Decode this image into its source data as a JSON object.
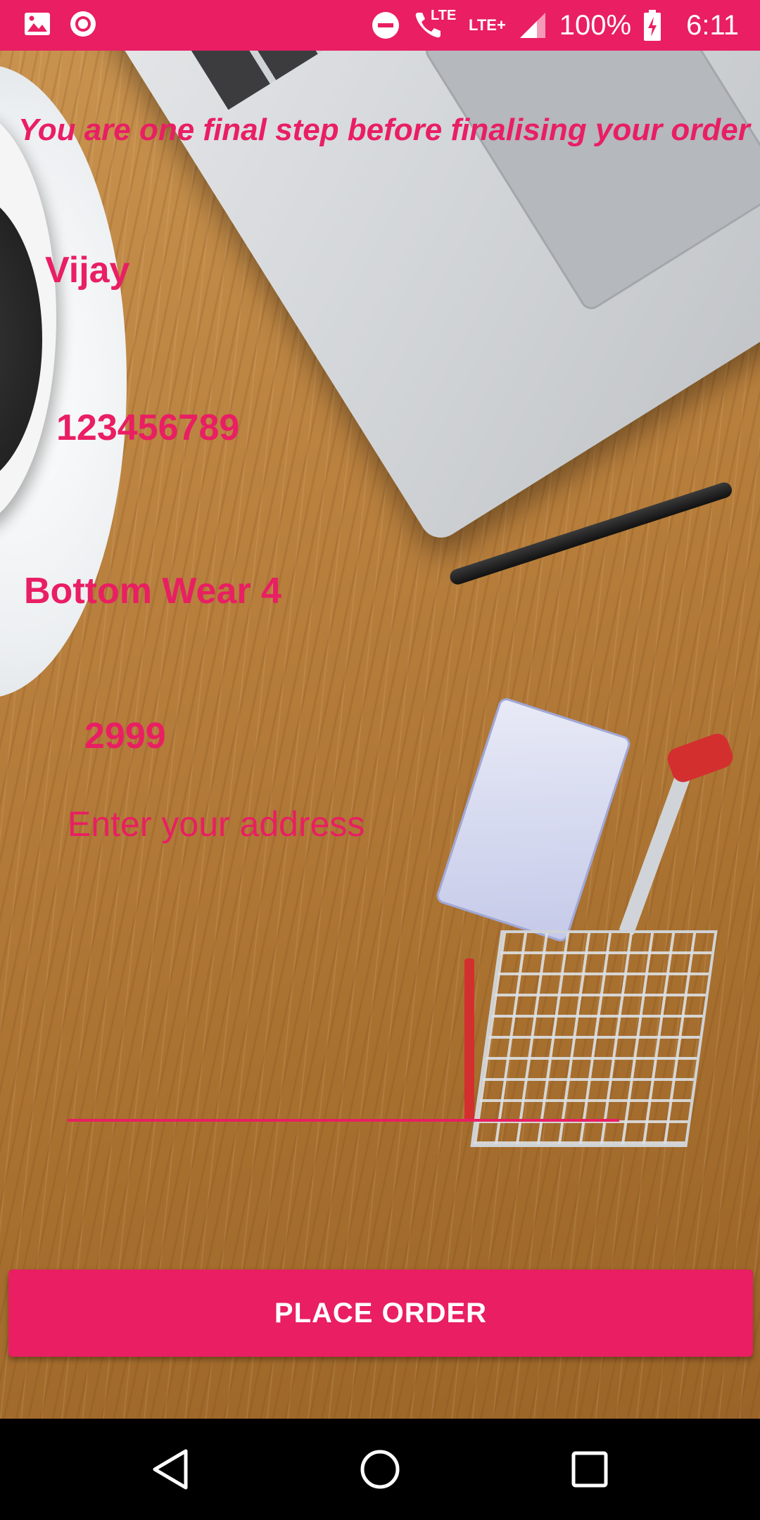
{
  "status_bar": {
    "battery": "100%",
    "time": "6:11",
    "network_1": "LTE",
    "network_2": "LTE+",
    "icons": [
      "image-icon",
      "record-icon",
      "do-not-disturb-icon",
      "wifi-call-icon",
      "lte-icon",
      "lte-plus-icon",
      "signal-icon",
      "battery-charging-icon"
    ]
  },
  "order": {
    "headline": "You are one final step before finalising your order",
    "name": "Vijay",
    "phone": "123456789",
    "product": "Bottom Wear 4",
    "price": "2999",
    "address_placeholder": "Enter your address",
    "address_value": ""
  },
  "actions": {
    "place_order_label": "PLACE ORDER"
  },
  "nav": {
    "icons": [
      "back-icon",
      "home-icon",
      "recents-icon"
    ]
  },
  "colors": {
    "accent": "#e91e63",
    "nav_background": "#000000"
  }
}
